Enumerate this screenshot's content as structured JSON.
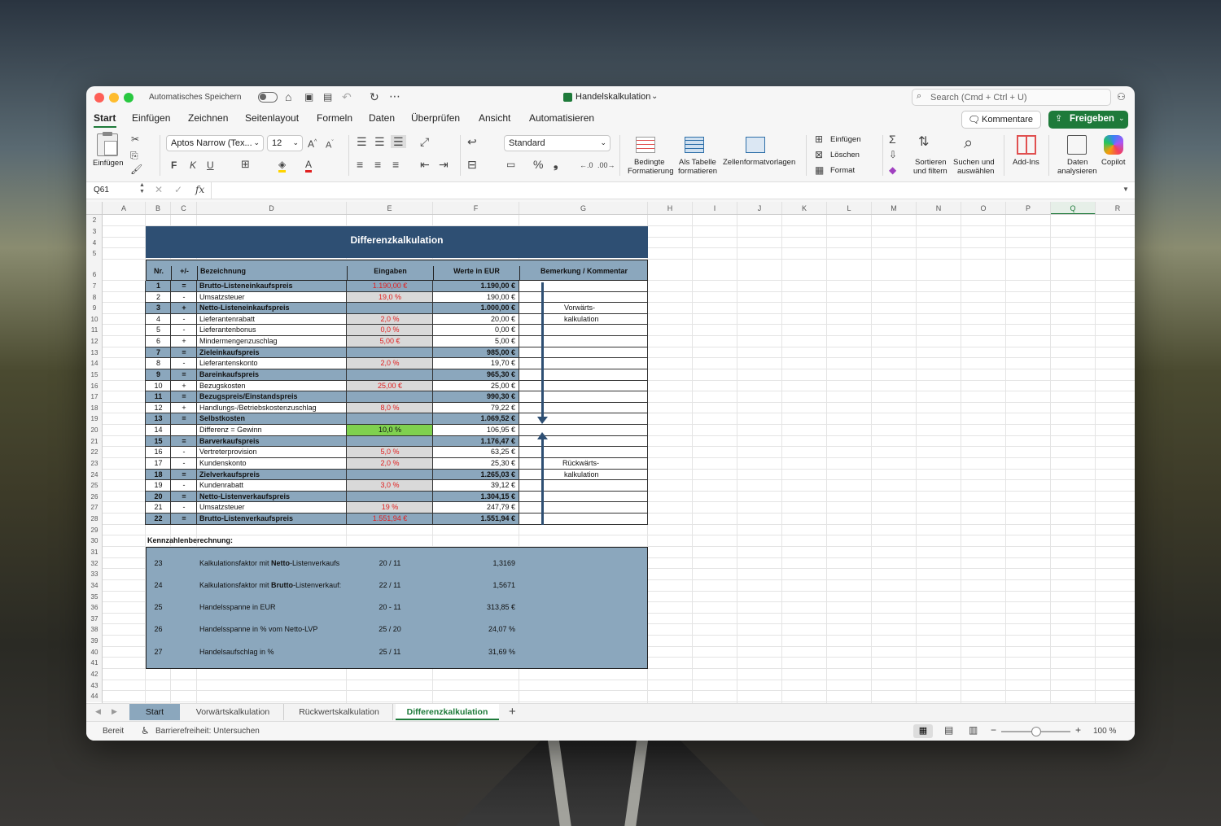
{
  "titlebar": {
    "autosave": "Automatisches Speichern",
    "filename": "Handelskalkulation",
    "search_placeholder": "Search (Cmd + Ctrl + U)"
  },
  "tabs": [
    "Start",
    "Einfügen",
    "Zeichnen",
    "Seitenlayout",
    "Formeln",
    "Daten",
    "Überprüfen",
    "Ansicht",
    "Automatisieren"
  ],
  "buttons": {
    "kommentare": "Kommentare",
    "freigeben": "Freigeben"
  },
  "ribbon": {
    "paste": "Einfügen",
    "font": "Aptos Narrow (Tex...",
    "size": "12",
    "bold": "F",
    "italic": "K",
    "underline": "U",
    "numfmt": "Standard",
    "cond1": "Bedingte",
    "cond2": "Formatierung",
    "table1": "Als Tabelle",
    "table2": "formatieren",
    "cellstyles": "Zellenformatvorlagen",
    "insert": "Einfügen",
    "delete": "Löschen",
    "format": "Format",
    "sort1": "Sortieren",
    "sort2": "und filtern",
    "find1": "Suchen und",
    "find2": "auswählen",
    "addins": "Add-Ins",
    "analyze1": "Daten",
    "analyze2": "analysieren",
    "copilot": "Copilot"
  },
  "formula": {
    "namebox": "Q61",
    "fx": "fx"
  },
  "columns": [
    "A",
    "B",
    "C",
    "D",
    "E",
    "F",
    "G",
    "H",
    "I",
    "J",
    "K",
    "L",
    "M",
    "N",
    "O",
    "P",
    "Q",
    "R"
  ],
  "rows": [
    "2",
    "3",
    "4",
    "5",
    "6",
    "7",
    "8",
    "9",
    "10",
    "11",
    "12",
    "13",
    "14",
    "15",
    "16",
    "17",
    "18",
    "19",
    "20",
    "21",
    "22",
    "23",
    "24",
    "25",
    "26",
    "27",
    "28",
    "29",
    "30",
    "31",
    "32",
    "33",
    "34",
    "35",
    "36",
    "37",
    "38",
    "39",
    "40",
    "41",
    "42",
    "43",
    "44"
  ],
  "sheet": {
    "title": "Differenzkalkulation",
    "headers": [
      "Nr.",
      "+/-",
      "Bezeichnung",
      "Eingaben",
      "Werte in EUR",
      "Bemerkung / Kommentar"
    ],
    "items": [
      {
        "nr": "1",
        "op": "=",
        "name": "Brutto-Listeneinkaufspreis",
        "input": "1.190,00 €",
        "value": "1.190,00 €",
        "hl": true
      },
      {
        "nr": "2",
        "op": "-",
        "name": "Umsatzsteuer",
        "input": "19,0 %",
        "value": "190,00 €",
        "hl": false
      },
      {
        "nr": "3",
        "op": "+",
        "name": "Netto-Listeneinkaufspreis",
        "input": "",
        "value": "1.000,00 €",
        "hl": true
      },
      {
        "nr": "4",
        "op": "-",
        "name": "Lieferantenrabatt",
        "input": "2,0 %",
        "value": "20,00 €",
        "hl": false
      },
      {
        "nr": "5",
        "op": "-",
        "name": "Lieferantenbonus",
        "input": "0,0 %",
        "value": "0,00 €",
        "hl": false
      },
      {
        "nr": "6",
        "op": "+",
        "name": "Mindermengenzuschlag",
        "input": "5,00 €",
        "value": "5,00 €",
        "hl": false
      },
      {
        "nr": "7",
        "op": "=",
        "name": "Zieleinkaufspreis",
        "input": "",
        "value": "985,00 €",
        "hl": true
      },
      {
        "nr": "8",
        "op": "-",
        "name": "Lieferantenskonto",
        "input": "2,0 %",
        "value": "19,70 €",
        "hl": false
      },
      {
        "nr": "9",
        "op": "=",
        "name": "Bareinkaufspreis",
        "input": "",
        "value": "965,30 €",
        "hl": true
      },
      {
        "nr": "10",
        "op": "+",
        "name": "Bezugskosten",
        "input": "25,00 €",
        "value": "25,00 €",
        "hl": false
      },
      {
        "nr": "11",
        "op": "=",
        "name": "Bezugspreis/Einstandspreis",
        "input": "",
        "value": "990,30 €",
        "hl": true
      },
      {
        "nr": "12",
        "op": "+",
        "name": "Handlungs-/Betriebskostenzuschlag",
        "input": "8,0 %",
        "value": "79,22 €",
        "hl": false
      },
      {
        "nr": "13",
        "op": "=",
        "name": "Selbstkosten",
        "input": "",
        "value": "1.069,52 €",
        "hl": true
      },
      {
        "nr": "14",
        "op": "",
        "name": "Differenz = Gewinn",
        "input": "10,0 %",
        "value": "106,95 €",
        "hl": false,
        "green": true
      },
      {
        "nr": "15",
        "op": "=",
        "name": "Barverkaufspreis",
        "input": "",
        "value": "1.176,47 €",
        "hl": true
      },
      {
        "nr": "16",
        "op": "-",
        "name": "Vertreterprovision",
        "input": "5,0 %",
        "value": "63,25 €",
        "hl": false
      },
      {
        "nr": "17",
        "op": "-",
        "name": "Kundenskonto",
        "input": "2,0 %",
        "value": "25,30 €",
        "hl": false
      },
      {
        "nr": "18",
        "op": "=",
        "name": "Zielverkaufspreis",
        "input": "",
        "value": "1.265,03 €",
        "hl": true
      },
      {
        "nr": "19",
        "op": "-",
        "name": "Kundenrabatt",
        "input": "3,0 %",
        "value": "39,12 €",
        "hl": false
      },
      {
        "nr": "20",
        "op": "=",
        "name": "Netto-Listenverkaufspreis",
        "input": "",
        "value": "1.304,15 €",
        "hl": true
      },
      {
        "nr": "21",
        "op": "-",
        "name": "Umsatzsteuer",
        "input": "19 %",
        "value": "247,79 €",
        "hl": false
      },
      {
        "nr": "22",
        "op": "=",
        "name": "Brutto-Listenverkaufspreis",
        "input": "1.551,94 €",
        "value": "1.551,94 €",
        "hl": true
      }
    ],
    "remark_fwd1": "Vorwärts-",
    "remark_fwd2": "kalkulation",
    "remark_bwd1": "Rückwärts-",
    "remark_bwd2": "kalkulation",
    "kz_title": "Kennzahlenberechnung:",
    "kz": [
      {
        "nr": "23",
        "pre": "Kalkulationsfaktor mit ",
        "b": "Netto",
        "post": "-Listenverkaufs",
        "ref": "20 / 11",
        "val": "1,3169"
      },
      {
        "nr": "24",
        "pre": "Kalkulationsfaktor mit ",
        "b": "Brutto",
        "post": "-Listenverkauf:",
        "ref": "22 / 11",
        "val": "1,5671"
      },
      {
        "nr": "25",
        "pre": "Handelsspanne in EUR",
        "b": "",
        "post": "",
        "ref": "20 - 11",
        "val": "313,85 €"
      },
      {
        "nr": "26",
        "pre": "Handelsspanne in % vom Netto-LVP",
        "b": "",
        "post": "",
        "ref": "25 / 20",
        "val": "24,07 %"
      },
      {
        "nr": "27",
        "pre": "Handelsaufschlag in %",
        "b": "",
        "post": "",
        "ref": "25 / 11",
        "val": "31,69 %"
      }
    ]
  },
  "sheettabs": [
    "Start",
    "Vorwärtskalkulation",
    "Rückwertskalkulation",
    "Differenzkalkulation"
  ],
  "status": {
    "ready": "Bereit",
    "access": "Barrierefreiheit: Untersuchen",
    "zoom": "100 %"
  },
  "colors": {
    "header_blue": "#2e4f73",
    "row_blue": "#8ba7bd",
    "accent_green": "#1e7a3a",
    "input_red": "#e02020",
    "gewinn_green": "#7fd14f"
  }
}
